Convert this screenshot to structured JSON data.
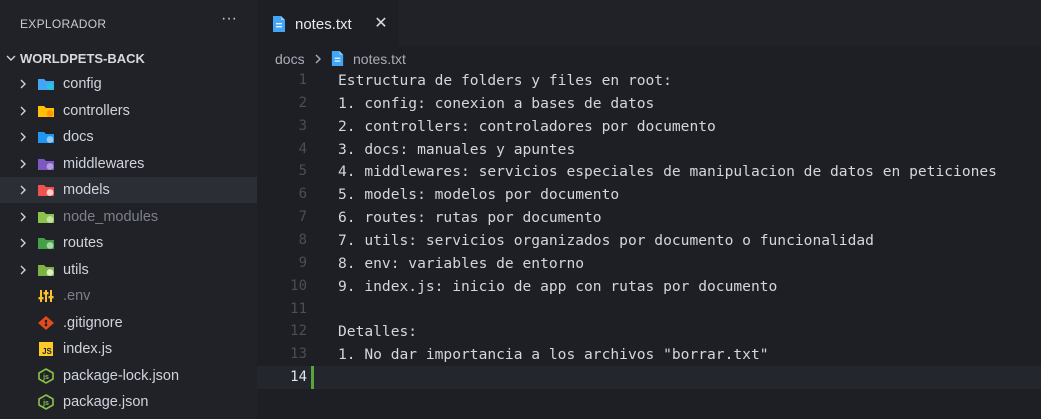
{
  "explorer": {
    "title": "EXPLORADOR",
    "more_actions": "···",
    "project": "WORLDPETS-BACK",
    "items": [
      {
        "label": "config",
        "type": "folder",
        "icon": "folder-config-icon",
        "color": "#42a5f5",
        "badge": "#26c6da"
      },
      {
        "label": "controllers",
        "type": "folder",
        "icon": "folder-controllers-icon",
        "color": "#ffc107",
        "badge": "#ff9800"
      },
      {
        "label": "docs",
        "type": "folder",
        "icon": "folder-docs-icon",
        "color": "#2196f3",
        "badge": "#90caf9"
      },
      {
        "label": "middlewares",
        "type": "folder",
        "icon": "folder-middlewares-icon",
        "color": "#7e57c2",
        "badge": "#b39ddb"
      },
      {
        "label": "models",
        "type": "folder",
        "icon": "folder-models-icon",
        "color": "#ef5350",
        "badge": "#ffcdd2",
        "selected": true
      },
      {
        "label": "node_modules",
        "type": "folder",
        "icon": "folder-node-icon",
        "color": "#8bc34a",
        "badge": "#c5e1a5",
        "dim": true
      },
      {
        "label": "routes",
        "type": "folder",
        "icon": "folder-routes-icon",
        "color": "#43a047",
        "badge": "#a5d6a7"
      },
      {
        "label": "utils",
        "type": "folder",
        "icon": "folder-utils-icon",
        "color": "#7cb342",
        "badge": "#dcedc8"
      },
      {
        "label": ".env",
        "type": "file",
        "icon": "env-settings-icon",
        "color": "#fbc02d",
        "dim": true
      },
      {
        "label": ".gitignore",
        "type": "file",
        "icon": "git-icon",
        "color": "#e64a19"
      },
      {
        "label": "index.js",
        "type": "file",
        "icon": "javascript-icon",
        "color": "#ffca28",
        "text": "JS"
      },
      {
        "label": "package-lock.json",
        "type": "file",
        "icon": "nodejs-icon",
        "color": "#8bc34a"
      },
      {
        "label": "package.json",
        "type": "file",
        "icon": "nodejs-icon",
        "color": "#8bc34a"
      }
    ]
  },
  "tab": {
    "label": "notes.txt",
    "icon": "file-text-icon",
    "close": "✕"
  },
  "breadcrumb": {
    "folder": "docs",
    "separator": "chevron-right-icon",
    "file": "notes.txt"
  },
  "editor": {
    "active_line": 14,
    "lines": [
      {
        "n": "1",
        "text": "Estructura de folders y files en root:"
      },
      {
        "n": "2",
        "text": "1. config: conexion a bases de datos"
      },
      {
        "n": "3",
        "text": "2. controllers: controladores por documento"
      },
      {
        "n": "4",
        "text": "3. docs: manuales y apuntes"
      },
      {
        "n": "5",
        "text": "4. middlewares: servicios especiales de manipulacion de datos en peticiones"
      },
      {
        "n": "6",
        "text": "5. models: modelos por documento"
      },
      {
        "n": "7",
        "text": "6. routes: rutas por documento"
      },
      {
        "n": "8",
        "text": "7. utils: servicios organizados por documento o funcionalidad"
      },
      {
        "n": "9",
        "text": "8. env: variables de entorno"
      },
      {
        "n": "10",
        "text": "9. index.js: inicio de app con rutas por documento"
      },
      {
        "n": "11",
        "text": ""
      },
      {
        "n": "12",
        "text": "Detalles:"
      },
      {
        "n": "13",
        "text": "1. No dar importancia a los archivos \"borrar.txt\""
      },
      {
        "n": "14",
        "text": ""
      }
    ]
  },
  "colors": {
    "accent_file": "#42a5f5",
    "modified_gutter": "#5aa53a"
  }
}
